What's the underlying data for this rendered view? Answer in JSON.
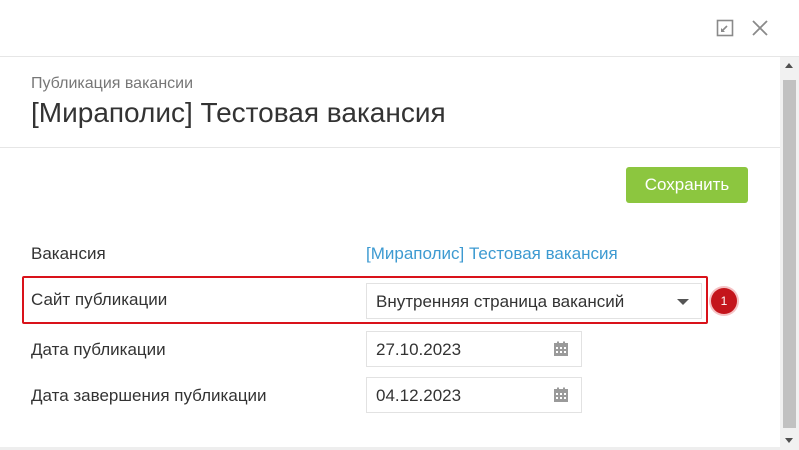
{
  "header": {
    "subtitle": "Публикация вакансии",
    "title": "[Мираполис] Тестовая вакансия"
  },
  "window_controls": {
    "expand_icon": "expand-icon",
    "close_icon": "close-icon"
  },
  "toolbar": {
    "save_label": "Сохранить",
    "save_color": "#8cc63f"
  },
  "form": {
    "vacancy": {
      "label": "Вакансия",
      "value": "[Мираполис] Тестовая вакансия",
      "link_color": "#3d9ad1"
    },
    "publication_site": {
      "label": "Сайт публикации",
      "value": "Внутренняя страница вакансий"
    },
    "publication_date": {
      "label": "Дата публикации",
      "value": "27.10.2023"
    },
    "end_date": {
      "label": "Дата завершения публикации",
      "value": "04.12.2023"
    }
  },
  "annotation": {
    "badge": "1",
    "color": "#d9121a"
  }
}
